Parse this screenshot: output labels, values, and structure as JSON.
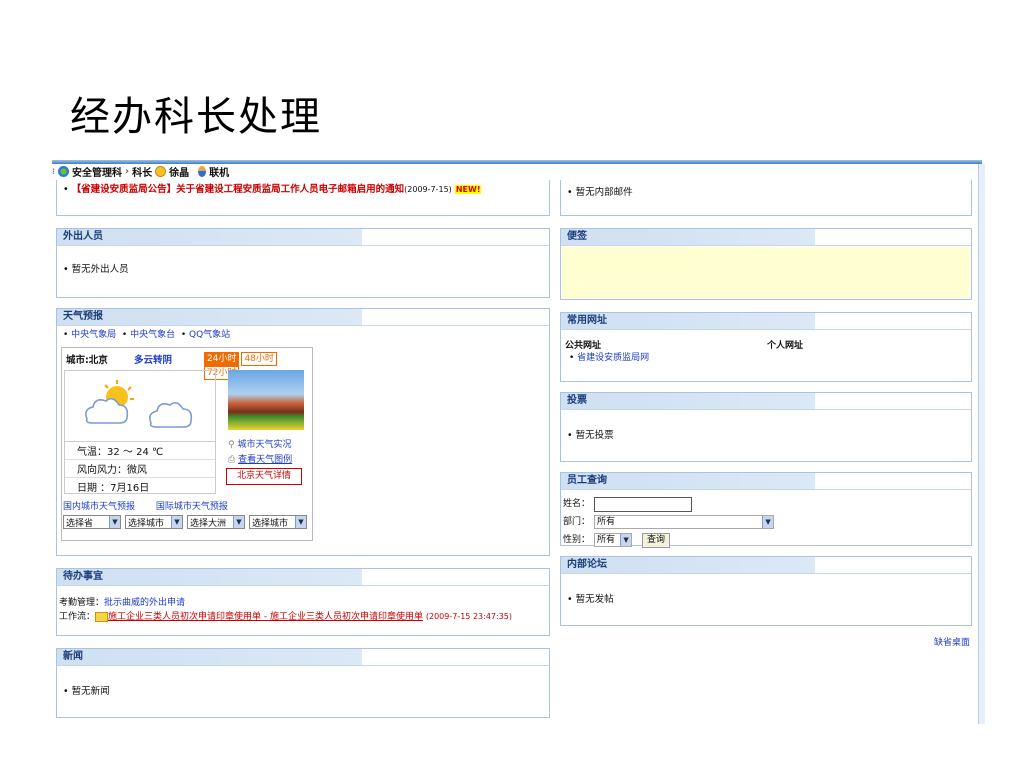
{
  "slide": {
    "title": "经办科长处理"
  },
  "userbar": {
    "dept": "安全管理科",
    "sep": "›",
    "role": "科长",
    "name": "徐晶",
    "status": "联机"
  },
  "notice": {
    "tag": "【省建设安质监局公告】",
    "text": "关于省建设工程安质监局工作人员电子邮箱启用的通知",
    "date": "(2009-7-15)",
    "badge": "NEW!"
  },
  "mail": {
    "text": "暂无内部邮件"
  },
  "outgoing": {
    "header": "外出人员",
    "text": "暂无外出人员"
  },
  "memo": {
    "header": "便签"
  },
  "weather": {
    "header": "天气预报",
    "links": [
      "中央气象局",
      "中央气象台",
      "QQ气象站"
    ],
    "city": "城市:北京",
    "condition": "多云转阴",
    "tabs": [
      "24小时",
      "48小时",
      "72小时"
    ],
    "temp": "气温：32 ～ 24 ℃",
    "wind": "风向风力：微风",
    "date": "日期 ：7月16日",
    "live": "城市天气实况",
    "legend": "查看天气图例",
    "detail": "北京天气详情",
    "domestic": "国内城市天气预报",
    "intl": "国际城市天气预报",
    "selects": [
      "选择省",
      "选择城市",
      "选择大洲",
      "选择城市"
    ]
  },
  "websites": {
    "header": "常用网址",
    "public_label": "公共网址",
    "private_label": "个人网址",
    "public_link": "省建设安质监局网"
  },
  "vote": {
    "header": "投票",
    "text": "暂无投票"
  },
  "employee": {
    "header": "员工查询",
    "name_label": "姓名：",
    "dept_label": "部门：",
    "dept_value": "所有",
    "gender_label": "性别：",
    "gender_value": "所有",
    "query_button": "查询"
  },
  "todo": {
    "header": "待办事宜",
    "att_label": "考勤管理：",
    "att_link": "批示曲威的外出申请",
    "wf_label": "工作流：",
    "wf_link": "施工企业三类人员初次申请印章使用单 - 施工企业三类人员初次申请印章使用单",
    "wf_date": "(2009-7-15 23:47:35)"
  },
  "forum": {
    "header": "内部论坛",
    "text": "暂无发帖"
  },
  "default_desktop": "缺省桌面",
  "news": {
    "header": "新闻",
    "text": "暂无新闻"
  }
}
